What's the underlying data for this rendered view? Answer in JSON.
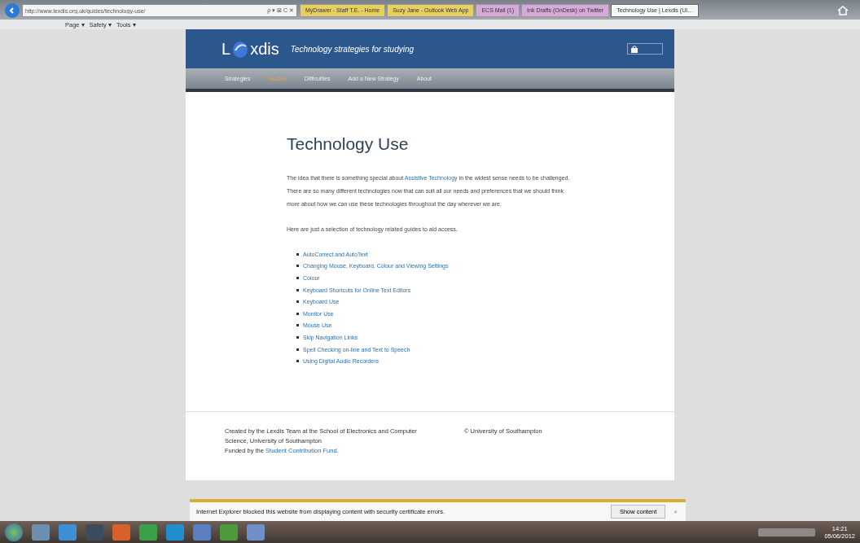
{
  "browser": {
    "address": "http://www.lexdis.org.uk/guides/technology-use/",
    "address_buttons": "ρ ▾ ⊠ C ✕",
    "tabs": [
      {
        "label": "MyDrawer - Staff T.E. - Home",
        "color": "#e8cf62",
        "selected": false
      },
      {
        "label": "Suzy Jane - Outlook Web App",
        "color": "#e8cf62",
        "selected": false
      },
      {
        "label": "ECS Mail (1)",
        "color": "#d7a9d9",
        "selected": false
      },
      {
        "label": "Ink Drafts (OnDesk) on Twitter",
        "color": "#d7a9d9",
        "selected": false
      },
      {
        "label": "Technology Use | Lexdis (UI…",
        "color": "#f4f6f8",
        "selected": true
      }
    ],
    "commands": [
      "Page ▾",
      "Safety ▾",
      "Tools ▾"
    ]
  },
  "site": {
    "logo_start": "L",
    "logo_end": "xdis",
    "tagline": "Technology strategies for studying",
    "nav": [
      {
        "label": "Strategies",
        "selected": false
      },
      {
        "label": "Guides",
        "selected": true
      },
      {
        "label": "Difficulties",
        "selected": false
      },
      {
        "label": "Add a New Strategy",
        "selected": false
      },
      {
        "label": "About",
        "selected": false
      }
    ]
  },
  "article": {
    "title": "Technology Use",
    "intro_before": "The idea that there is something special about ",
    "intro_link": "Assistive Technology",
    "intro_after": " in the widest sense needs to be challenged. There are so many different technologies now that can suit all our needs and preferences that we should think more about how we can use these technologies throughout the day wherever we are.",
    "lead": "Here are just a selection of technology related guides to aid access.",
    "guides": [
      "AutoCorrect and AutoText",
      "Changing Mouse, Keyboard, Colour and Viewing Settings",
      "Colour",
      "Keyboard Shortcuts for Online Text Editors",
      "Keyboard Use",
      "Monitor Use",
      "Mouse Use",
      "Skip Navigation Links",
      "Spell Checking on-line and Text to Speech",
      "Using Digital Audio Recorders"
    ]
  },
  "footer": {
    "credit": "Created by the Lexdis Team at the School of Electronics and Computer Science, University of Southampton",
    "funded_before": "Funded by the ",
    "funded_link": "Student Contribution Fund",
    "funded_after": ".",
    "copyright": "© University of Southampton"
  },
  "notification": {
    "message": "Internet Explorer blocked this website from displaying content with security certificate errors.",
    "button": "Show content",
    "close": "×"
  },
  "taskbar": {
    "time": "14:21",
    "date": "05/06/2012"
  }
}
